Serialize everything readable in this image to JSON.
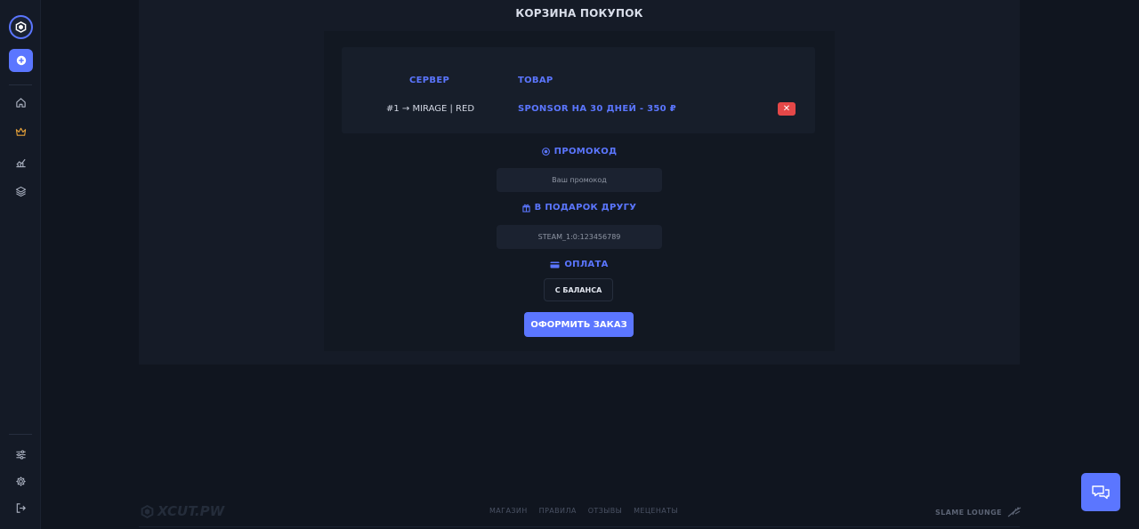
{
  "page": {
    "title": "КОРЗИНА ПОКУПОК"
  },
  "cart": {
    "headers": {
      "server": "СЕРВЕР",
      "product": "ТОВАР"
    },
    "rows": [
      {
        "server": "#1 → MIRAGE | RED",
        "product": "SPONSOR НА 30 ДНЕЙ - 350 ₽",
        "remove_label": "✕"
      }
    ]
  },
  "promo": {
    "label": "ПРОМОКОД",
    "placeholder": "Ваш промокод"
  },
  "gift": {
    "label": "В ПОДАРОК ДРУГУ",
    "placeholder": "STEAM_1:0:123456789"
  },
  "payment": {
    "label": "ОПЛАТА",
    "method": "С БАЛАНСА"
  },
  "order_button": "ОФОРМИТЬ ЗАКАЗ",
  "footer": {
    "logo": "XCUT.PW",
    "nav": [
      "МАГАЗИН",
      "ПРАВИЛА",
      "ОТЗЫВЫ",
      "МЕЦЕНАТЫ"
    ],
    "right": "SLAME LOUNGE"
  },
  "sidebar": {
    "icons": [
      "logo-icon",
      "plus-icon",
      "home-icon",
      "crown-icon",
      "chart-icon",
      "layers-icon",
      "sliders-icon",
      "gear-icon",
      "logout-icon"
    ]
  },
  "colors": {
    "accent": "#5b76ff",
    "danger": "#e54848",
    "background": "#10151f",
    "panel": "#151b27",
    "crown": "#e8a33a"
  }
}
